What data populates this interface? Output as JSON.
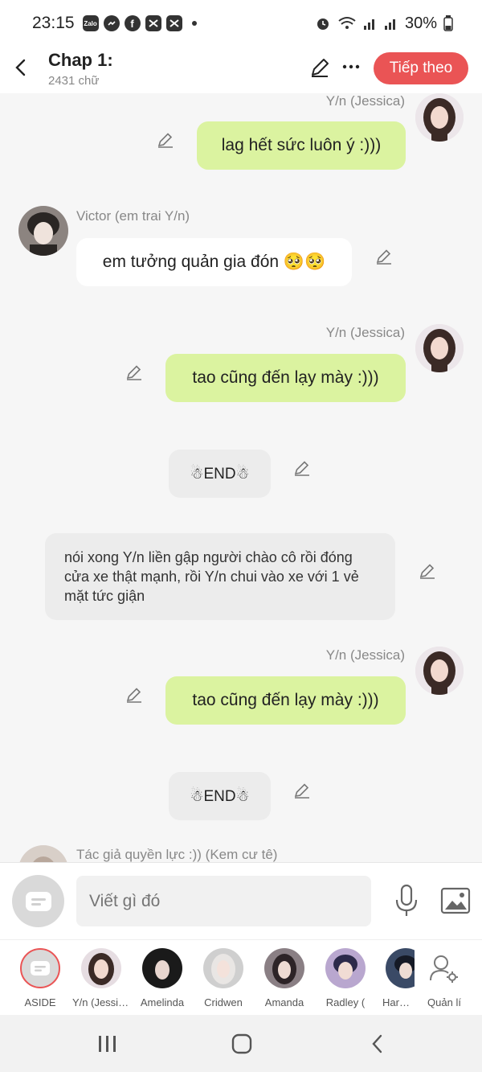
{
  "status_bar": {
    "time": "23:15",
    "app_icons": [
      "zalo-icon",
      "messenger-icon",
      "facebook-icon",
      "capcut-icon",
      "capcut-icon"
    ],
    "battery": "30%"
  },
  "header": {
    "title": "Chap 1:",
    "word_count": "2431 chữ",
    "next_label": "Tiếp theo"
  },
  "messages": [
    {
      "type": "right",
      "name": "Y/n (Jessica)",
      "text": "lag hết sức luôn ý :)))"
    },
    {
      "type": "left",
      "name": "Victor (em trai Y/n)",
      "text": "em tưởng quản gia đón 🥺🥺"
    },
    {
      "type": "right",
      "name": "Y/n (Jessica)",
      "text": "tao cũng đến lạy mày :)))"
    },
    {
      "type": "aside",
      "text": "☃END☃"
    },
    {
      "type": "narration",
      "text": "nói xong Y/n liền gập người chào cô rồi đóng cửa xe thật mạnh, rồi Y/n chui vào xe với 1 vẻ mặt tức giận"
    },
    {
      "type": "right",
      "name": "Y/n (Jessica)",
      "text": "tao cũng đến lạy mày :)))"
    },
    {
      "type": "aside",
      "text": "☃END☃"
    },
    {
      "type": "left",
      "name": "Tác giả quyền lực :)) (Kem cư tê)",
      "text": ""
    }
  ],
  "input": {
    "placeholder": "Viết gì đó"
  },
  "characters": [
    {
      "label": "ASIDE",
      "color": "#d9d9d9"
    },
    {
      "label": "Y/n (Jessica)",
      "color": "#e6dde2"
    },
    {
      "label": "Amelinda",
      "color": "#1a1a1a"
    },
    {
      "label": "Cridwen",
      "color": "#cfcfcf"
    },
    {
      "label": "Amanda",
      "color": "#8a7f84"
    },
    {
      "label": "Radley (",
      "color": "#7a7090"
    },
    {
      "label": "Harvey",
      "color": "#3a4a66"
    },
    {
      "label": "Quản lí",
      "color": "#ffffff"
    }
  ]
}
